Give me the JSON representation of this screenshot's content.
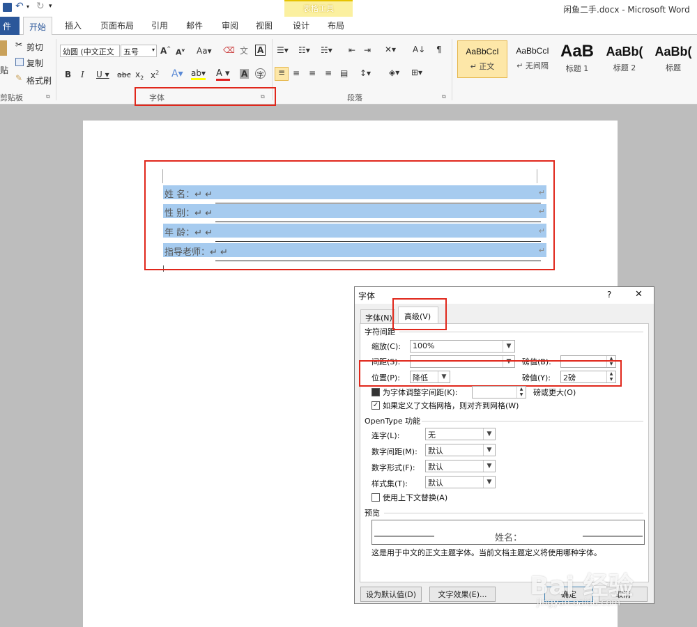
{
  "window": {
    "title": "闲鱼二手.docx - Microsoft Word",
    "table_tools": "表格工具"
  },
  "tabs": {
    "file": "件",
    "home": "开始",
    "insert": "插入",
    "layout": "页面布局",
    "references": "引用",
    "mailings": "邮件",
    "review": "审阅",
    "view": "视图",
    "design": "设计",
    "table_layout": "布局"
  },
  "clipboard": {
    "paste": "贴",
    "cut": "剪切",
    "copy": "复制",
    "format_painter": "格式刷",
    "label": "剪贴板"
  },
  "font_group": {
    "font_name": "幼圆 (中文正文",
    "font_size": "五号",
    "label": "字体"
  },
  "paragraph_group": {
    "label": "段落"
  },
  "styles": [
    {
      "sample": "AaBbCcI",
      "label": "↵ 正文"
    },
    {
      "sample": "AaBbCcI",
      "label": "↵ 无间隔"
    },
    {
      "sample": "AaB",
      "label": "标题 1"
    },
    {
      "sample": "AaBb(",
      "label": "标题 2"
    },
    {
      "sample": "AaBb(",
      "label": "标题"
    }
  ],
  "document": {
    "rows": [
      {
        "label": "姓    名：↵ ↵"
      },
      {
        "label": "性    别：↵ ↵"
      },
      {
        "label": "年    龄：↵ ↵"
      },
      {
        "label": "指导老师：↵ ↵"
      }
    ],
    "row_end_mark": "↵"
  },
  "dialog": {
    "title": "字体",
    "help": "?",
    "close": "✕",
    "tab_font": "字体(N)",
    "tab_advanced": "高级(V)",
    "spacing_section": "字符间距",
    "scale_label": "缩放(C):",
    "scale_value": "100%",
    "spacing_label": "间距(S):",
    "spacing_value": "",
    "spacing_by_label": "磅值(B):",
    "spacing_by_value": "",
    "position_label": "位置(P):",
    "position_value": "降低",
    "position_by_label": "磅值(Y):",
    "position_by_value": "2磅",
    "kerning_label": "为字体调整字间距(K):",
    "kerning_value": "",
    "kerning_suffix": "磅或更大(O)",
    "grid_label": "如果定义了文档网格，则对齐到网格(W)",
    "opentype_section": "OpenType 功能",
    "ligatures_label": "连字(L):",
    "ligatures_value": "无",
    "num_spacing_label": "数字间距(M):",
    "num_spacing_value": "默认",
    "num_forms_label": "数字形式(F):",
    "num_forms_value": "默认",
    "stylistic_label": "样式集(T):",
    "stylistic_value": "默认",
    "contextual_label": "使用上下文替换(A)",
    "preview_section": "预览",
    "preview_text": "姓名：",
    "preview_desc": "这是用于中文的正文主题字体。当前文档主题定义将使用哪种字体。",
    "set_default": "设为默认值(D)",
    "text_effects": "文字效果(E)...",
    "ok": "确定",
    "cancel": "取消"
  },
  "watermark": {
    "brand": "Bai 经验",
    "url": "jingyan.baidu.com"
  },
  "colors": {
    "accent": "#2b579a",
    "highlight": "#a6cbef",
    "annotation": "#e0271b"
  }
}
